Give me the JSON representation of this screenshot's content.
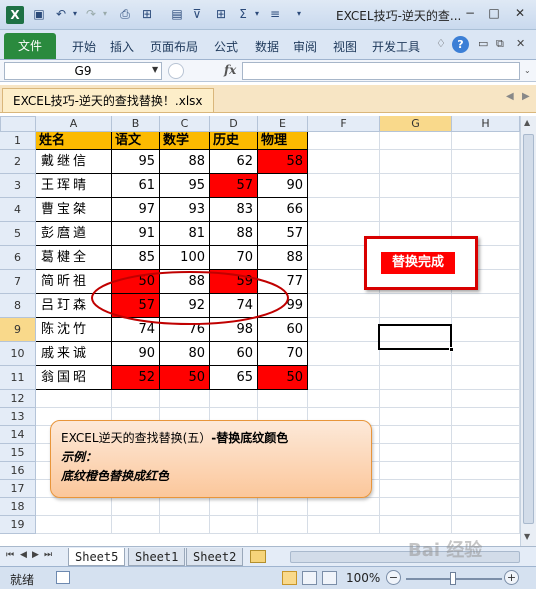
{
  "window": {
    "title": "EXCEL技巧-逆天的查...",
    "app_icon_letter": "X",
    "controls": [
      "−",
      "□",
      "✕"
    ]
  },
  "ribbon": {
    "file_tab": "文件",
    "tabs": [
      "开始",
      "插入",
      "页面布局",
      "公式",
      "数据",
      "审阅",
      "视图",
      "开发工具"
    ],
    "help": "?"
  },
  "formula_bar": {
    "cell_ref": "G9",
    "fx": "fx",
    "formula": ""
  },
  "workbook_tab": "EXCEL技巧-逆天的查找替换！.xlsx",
  "columns": [
    "A",
    "B",
    "C",
    "D",
    "E",
    "F",
    "G",
    "H"
  ],
  "rows": [
    "1",
    "2",
    "3",
    "4",
    "5",
    "6",
    "7",
    "8",
    "9",
    "10",
    "11",
    "12",
    "13",
    "14",
    "15",
    "16",
    "17",
    "18",
    "19"
  ],
  "table": {
    "headers": [
      "姓名",
      "语文",
      "数学",
      "历史",
      "物理"
    ],
    "rows": [
      {
        "name": "戴继信",
        "scores": [
          "95",
          "88",
          "62",
          "58"
        ],
        "red": [
          false,
          false,
          false,
          true
        ]
      },
      {
        "name": "王珲晴",
        "scores": [
          "61",
          "95",
          "57",
          "90"
        ],
        "red": [
          false,
          false,
          true,
          false
        ]
      },
      {
        "name": "曹宝桀",
        "scores": [
          "97",
          "93",
          "83",
          "66"
        ],
        "red": [
          false,
          false,
          false,
          false
        ]
      },
      {
        "name": "彭麿遒",
        "scores": [
          "91",
          "81",
          "88",
          "57"
        ],
        "red": [
          false,
          false,
          false,
          false
        ]
      },
      {
        "name": "葛楗全",
        "scores": [
          "85",
          "100",
          "70",
          "88"
        ],
        "red": [
          false,
          false,
          false,
          false
        ]
      },
      {
        "name": "简昕祖",
        "scores": [
          "50",
          "88",
          "59",
          "77"
        ],
        "red": [
          true,
          false,
          true,
          false
        ]
      },
      {
        "name": "吕玎森",
        "scores": [
          "57",
          "92",
          "74",
          "99"
        ],
        "red": [
          true,
          false,
          false,
          false
        ]
      },
      {
        "name": "陈沈竹",
        "scores": [
          "74",
          "76",
          "98",
          "60"
        ],
        "red": [
          false,
          false,
          false,
          false
        ]
      },
      {
        "name": "戚来诚",
        "scores": [
          "90",
          "80",
          "60",
          "70"
        ],
        "red": [
          false,
          false,
          false,
          false
        ]
      },
      {
        "name": "翁国昭",
        "scores": [
          "52",
          "50",
          "65",
          "50"
        ],
        "red": [
          true,
          true,
          false,
          true
        ]
      }
    ]
  },
  "colors": {
    "header_fill": "#fcba00",
    "highlight_fill": "#ff0000",
    "oval_stroke": "#c00000"
  },
  "done_label": "替换完成",
  "note": {
    "line1_plain": "EXCEL逆天的查找替换(五）",
    "line1_bold": "-替换底纹颜色",
    "line2": "示例：",
    "line3": "底纹橙色替换成红色"
  },
  "sheets": [
    "Sheet5",
    "Sheet1",
    "Sheet2"
  ],
  "active_sheet": "Sheet5",
  "status": {
    "ready": "就绪",
    "zoom": "100%"
  },
  "watermark": "Bai 经验"
}
